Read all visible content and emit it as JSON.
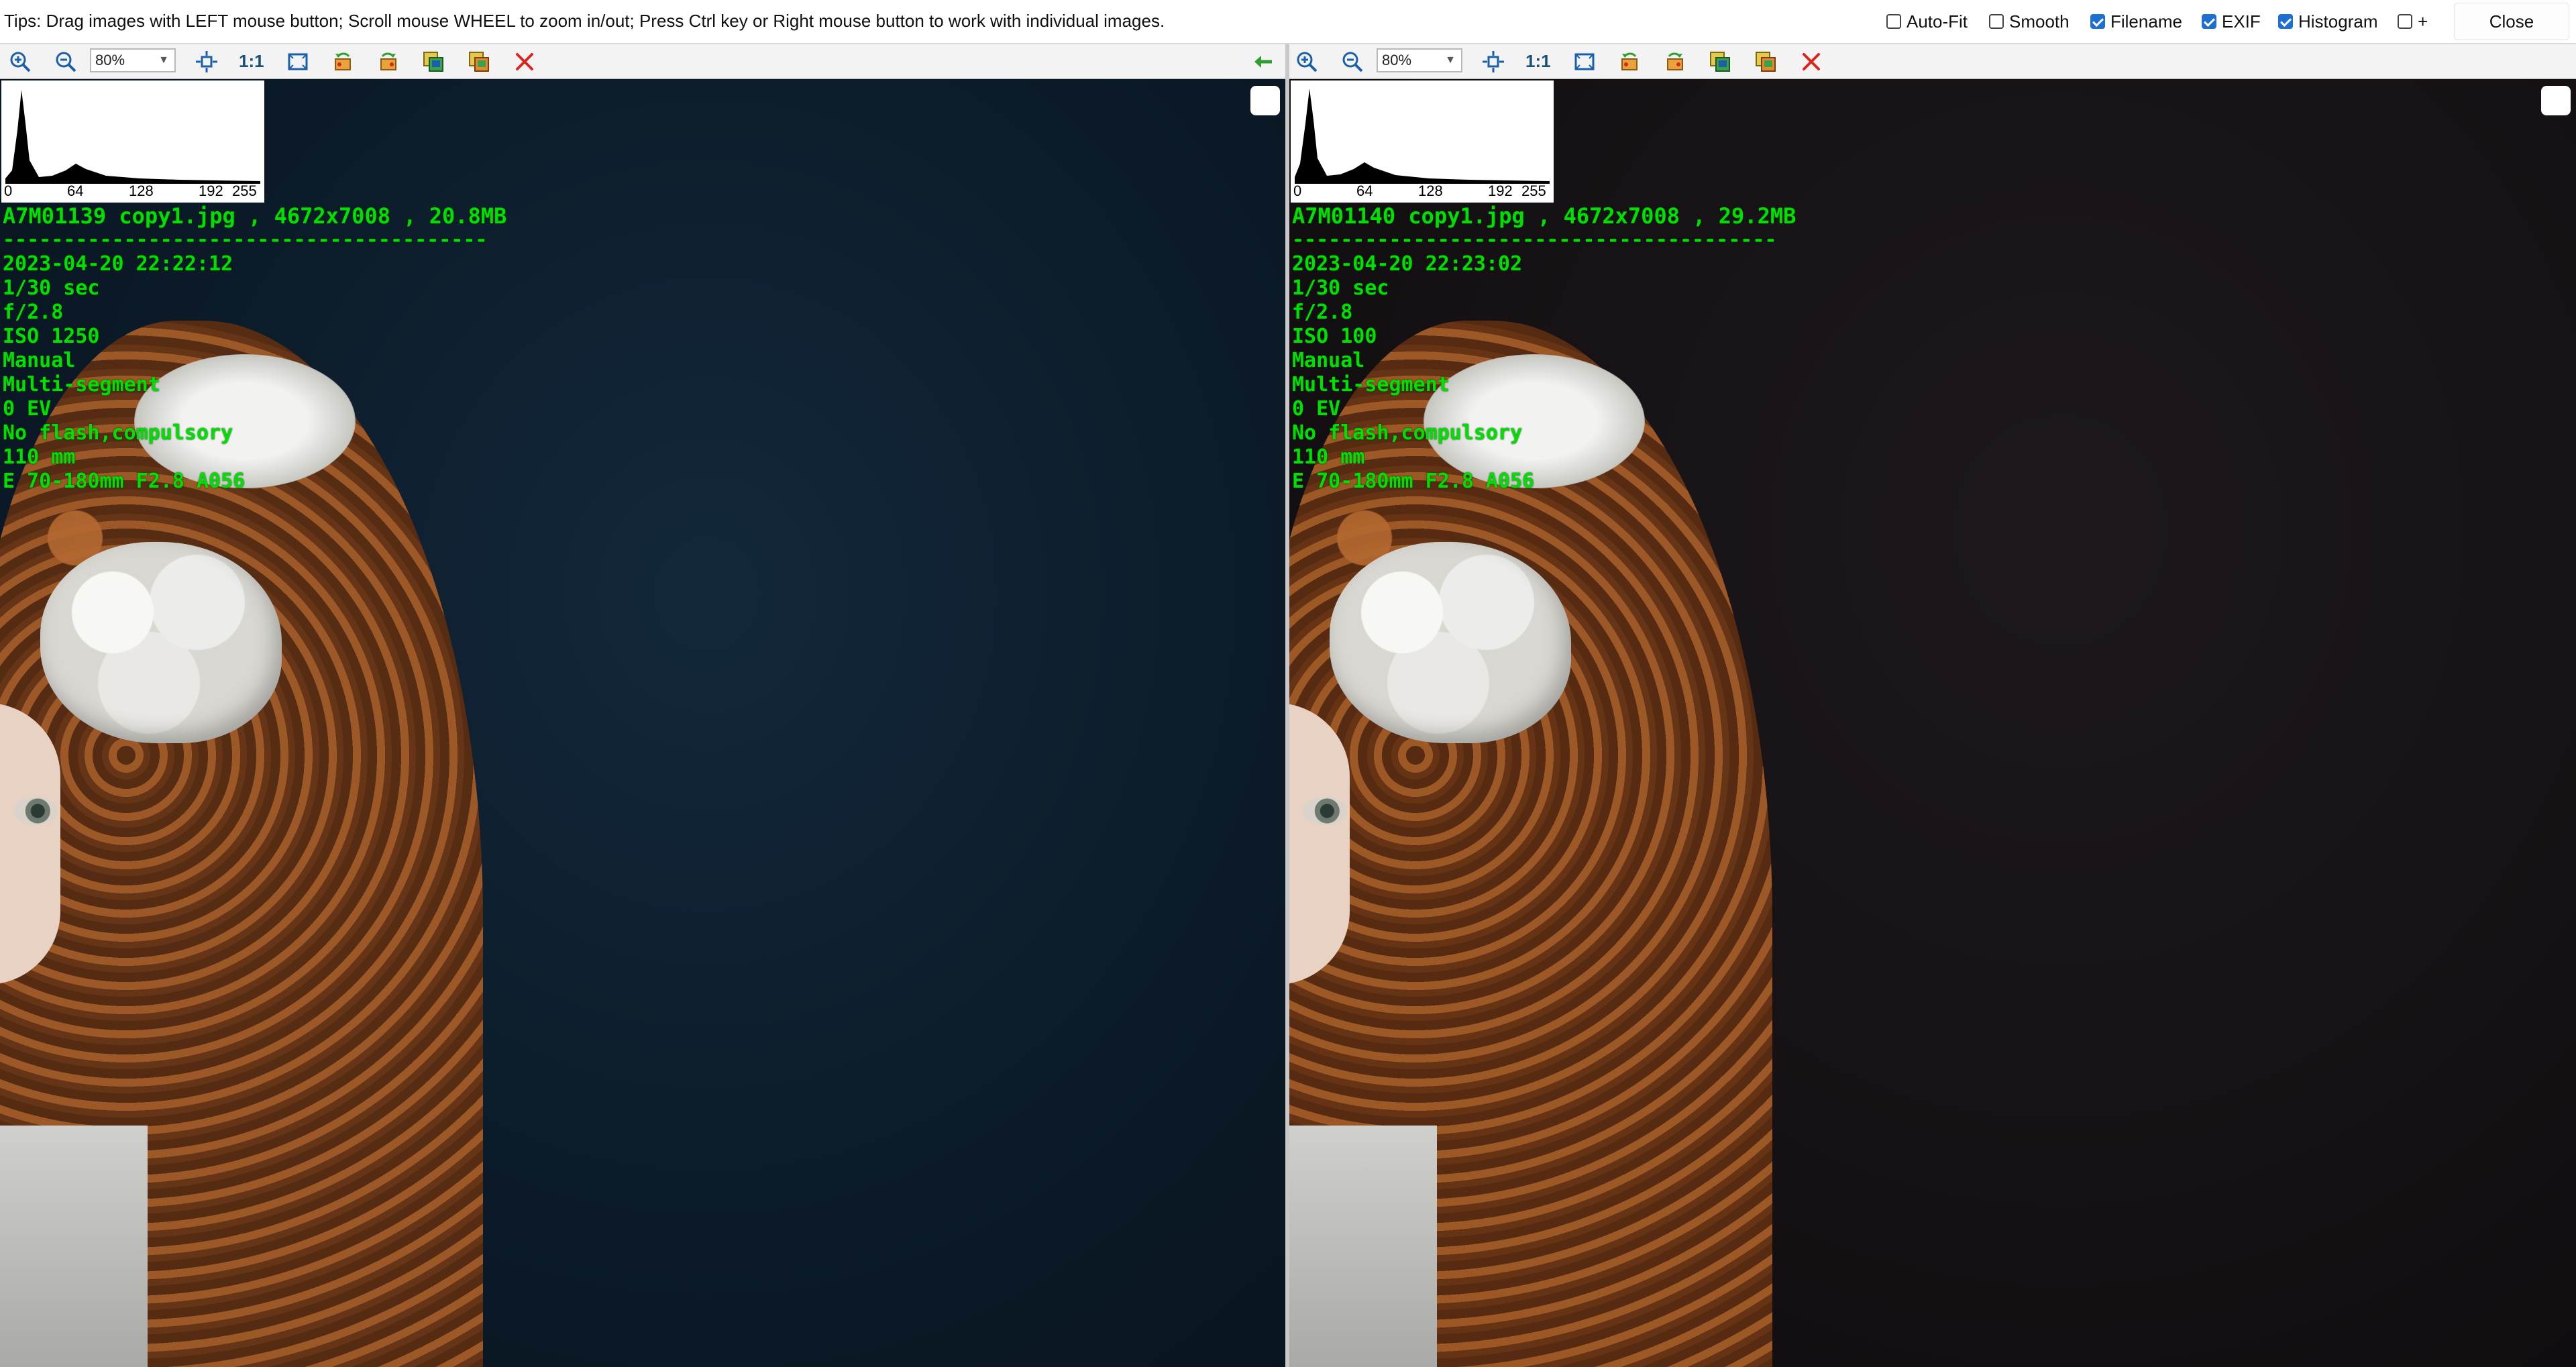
{
  "tips_bar": {
    "text": "Tips: Drag images with LEFT mouse button; Scroll mouse WHEEL to zoom in/out; Press Ctrl key or Right mouse button to work with individual images.",
    "options": [
      {
        "label": "Auto-Fit",
        "checked": false
      },
      {
        "label": "Smooth",
        "checked": false
      },
      {
        "label": "Filename",
        "checked": true
      },
      {
        "label": "EXIF",
        "checked": true
      },
      {
        "label": "Histogram",
        "checked": true
      },
      {
        "label": "+",
        "checked": false
      }
    ],
    "close_label": "Close"
  },
  "toolbar": {
    "zoom_value": "80%",
    "one_to_one": "1:1"
  },
  "histogram_ticks": [
    "0",
    "64",
    "128",
    "192",
    "255"
  ],
  "images": [
    {
      "filename_line": "A7M01139 copy1.jpg , 4672x7008 , 20.8MB",
      "separator": "----------------------------------------",
      "datetime": "2023-04-20 22:22:12",
      "shutter": "1/30 sec",
      "aperture": "f/2.8",
      "iso": "ISO 1250",
      "mode": "Manual",
      "metering": "Multi-segment",
      "ev": "0 EV",
      "flash": "No flash,compulsory",
      "focal": "110 mm",
      "lens": "E 70-180mm F2.8 A056"
    },
    {
      "filename_line": "A7M01140 copy1.jpg , 4672x7008 , 29.2MB",
      "separator": "----------------------------------------",
      "datetime": "2023-04-20 22:23:02",
      "shutter": "1/30 sec",
      "aperture": "f/2.8",
      "iso": "ISO 100",
      "mode": "Manual",
      "metering": "Multi-segment",
      "ev": "0 EV",
      "flash": "No flash,compulsory",
      "focal": "110 mm",
      "lens": "E 70-180mm F2.8 A056"
    }
  ],
  "icons": {
    "zoom_in": "zoom-in-icon",
    "zoom_out": "zoom-out-icon",
    "fit": "fit-window-icon",
    "full": "full-size-icon",
    "rotate_left": "rotate-left-icon",
    "rotate_right": "rotate-right-icon",
    "copy": "copy-icon",
    "save": "save-icon",
    "close": "close-x-icon",
    "sync": "sync-arrow-icon"
  },
  "colors": {
    "overlay_text": "#00e000",
    "icon_blue": "#1a5fa8",
    "close_red": "#d8261d",
    "sync_green": "#2e9e2e"
  }
}
